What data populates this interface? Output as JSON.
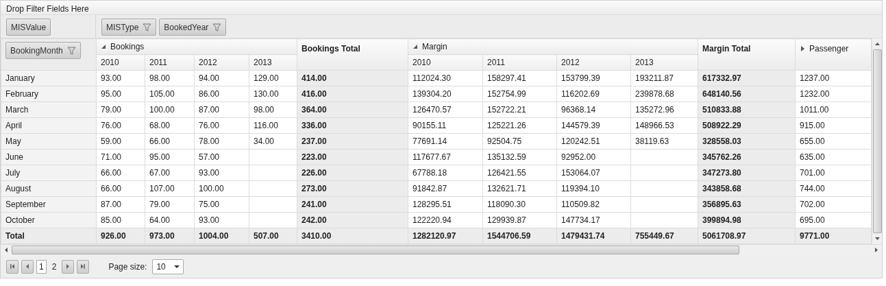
{
  "filter_area": {
    "label": "Drop Filter Fields Here"
  },
  "data_fields": [
    {
      "label": "MISValue",
      "filter": false
    }
  ],
  "column_fields": [
    {
      "label": "MISType",
      "filter": true
    },
    {
      "label": "BookedYear",
      "filter": true
    }
  ],
  "row_fields": [
    {
      "label": "BookingMonth",
      "filter": true
    }
  ],
  "column_groups": [
    {
      "kind": "group",
      "label": "Bookings",
      "expanded": true,
      "years": [
        "2010",
        "2011",
        "2012",
        "2013"
      ]
    },
    {
      "kind": "total",
      "label": "Bookings Total"
    },
    {
      "kind": "group",
      "label": "Margin",
      "expanded": true,
      "years": [
        "2010",
        "2011",
        "2012",
        "2013"
      ]
    },
    {
      "kind": "total",
      "label": "Margin Total"
    },
    {
      "kind": "group",
      "label": "Passenger",
      "expanded": false
    }
  ],
  "rows": [
    {
      "label": "January",
      "cells": [
        "93.00",
        "98.00",
        "94.00",
        "129.00",
        "414.00",
        "112024.30",
        "158297.41",
        "153799.39",
        "193211.87",
        "617332.97",
        "1237.00"
      ]
    },
    {
      "label": "February",
      "cells": [
        "95.00",
        "105.00",
        "86.00",
        "130.00",
        "416.00",
        "139304.20",
        "152754.99",
        "116202.69",
        "239878.68",
        "648140.56",
        "1232.00"
      ]
    },
    {
      "label": "March",
      "cells": [
        "79.00",
        "100.00",
        "87.00",
        "98.00",
        "364.00",
        "126470.57",
        "152722.21",
        "96368.14",
        "135272.96",
        "510833.88",
        "1011.00"
      ]
    },
    {
      "label": "April",
      "cells": [
        "76.00",
        "68.00",
        "76.00",
        "116.00",
        "336.00",
        "90155.11",
        "125221.26",
        "144579.39",
        "148966.53",
        "508922.29",
        "915.00"
      ]
    },
    {
      "label": "May",
      "cells": [
        "59.00",
        "66.00",
        "78.00",
        "34.00",
        "237.00",
        "77691.14",
        "92504.75",
        "120242.51",
        "38119.63",
        "328558.03",
        "655.00"
      ]
    },
    {
      "label": "June",
      "cells": [
        "71.00",
        "95.00",
        "57.00",
        null,
        "223.00",
        "117677.67",
        "135132.59",
        "92952.00",
        null,
        "345762.26",
        "635.00"
      ]
    },
    {
      "label": "July",
      "cells": [
        "66.00",
        "67.00",
        "93.00",
        null,
        "226.00",
        "67788.18",
        "126421.55",
        "153064.07",
        null,
        "347273.80",
        "701.00"
      ]
    },
    {
      "label": "August",
      "cells": [
        "66.00",
        "107.00",
        "100.00",
        null,
        "273.00",
        "91842.87",
        "132621.71",
        "119394.10",
        null,
        "343858.68",
        "744.00"
      ]
    },
    {
      "label": "September",
      "cells": [
        "87.00",
        "79.00",
        "75.00",
        null,
        "241.00",
        "128295.51",
        "118090.30",
        "110509.82",
        null,
        "356895.63",
        "702.00"
      ]
    },
    {
      "label": "October",
      "cells": [
        "85.00",
        "64.00",
        "93.00",
        null,
        "242.00",
        "122220.94",
        "129939.87",
        "147734.17",
        null,
        "399894.98",
        "695.00"
      ]
    }
  ],
  "total_row": {
    "label": "Total",
    "cells": [
      "926.00",
      "973.00",
      "1004.00",
      "507.00",
      "3410.00",
      "1282120.97",
      "1544706.59",
      "1479431.74",
      "755449.67",
      "5061708.97",
      "9771.00"
    ]
  },
  "pager": {
    "pages": [
      {
        "label": "1",
        "selected": true
      },
      {
        "label": "2",
        "selected": false
      }
    ],
    "page_size_label": "Page size:",
    "page_size": "10"
  }
}
